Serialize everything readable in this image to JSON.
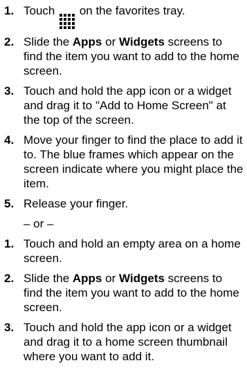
{
  "icons": {
    "apps_grid": "apps-grid-icon"
  },
  "steps_a": [
    {
      "num": "1.",
      "before_icon": "Touch ",
      "after_icon": " on the favorites tray."
    },
    {
      "num": "2.",
      "pre": "Slide the ",
      "b1": "Apps",
      "mid": " or ",
      "b2": "Widgets",
      "post": " screens to find the item you want to add to the home screen."
    },
    {
      "num": "3.",
      "text": "Touch and hold the app icon or a widget and drag it to \"Add to Home Screen\" at the top of the screen."
    },
    {
      "num": "4.",
      "text": "Move your finger to find the place to add it to. The blue frames which appear on the screen indicate where you might place the item."
    },
    {
      "num": "5.",
      "text": "Release your finger."
    }
  ],
  "or_text": "– or –",
  "steps_b": [
    {
      "num": "1.",
      "text": "Touch and hold an empty area on a home screen."
    },
    {
      "num": "2.",
      "pre": "Slide the ",
      "b1": "Apps",
      "mid": " or ",
      "b2": "Widgets",
      "post": " screens to find the item you want to add to the home screen."
    },
    {
      "num": "3.",
      "text": "Touch and hold the app icon or a widget and drag it to a home screen thumbnail where you want to add it."
    }
  ]
}
